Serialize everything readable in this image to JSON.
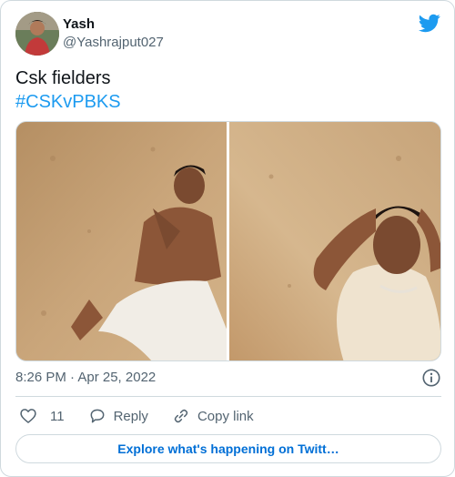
{
  "tweet": {
    "author_name": "Yash",
    "author_handle": "@Yashrajput027",
    "text_line1": "Csk fielders",
    "hashtag": "#CSKvPBKS",
    "timestamp": "8:26 PM · Apr 25, 2022"
  },
  "actions": {
    "likes": "11",
    "reply_label": "Reply",
    "copy_link_label": "Copy link"
  },
  "explore": {
    "label": "Explore what's happening on Twitt…"
  },
  "icons": {
    "brand": "twitter-bird-icon",
    "info": "info-icon",
    "like": "heart-icon",
    "reply": "reply-icon",
    "copy": "link-icon"
  },
  "colors": {
    "brand_blue": "#1d9bf0",
    "link_blue": "#006fd6",
    "secondary_text": "#536471",
    "border": "#cfd9de"
  }
}
